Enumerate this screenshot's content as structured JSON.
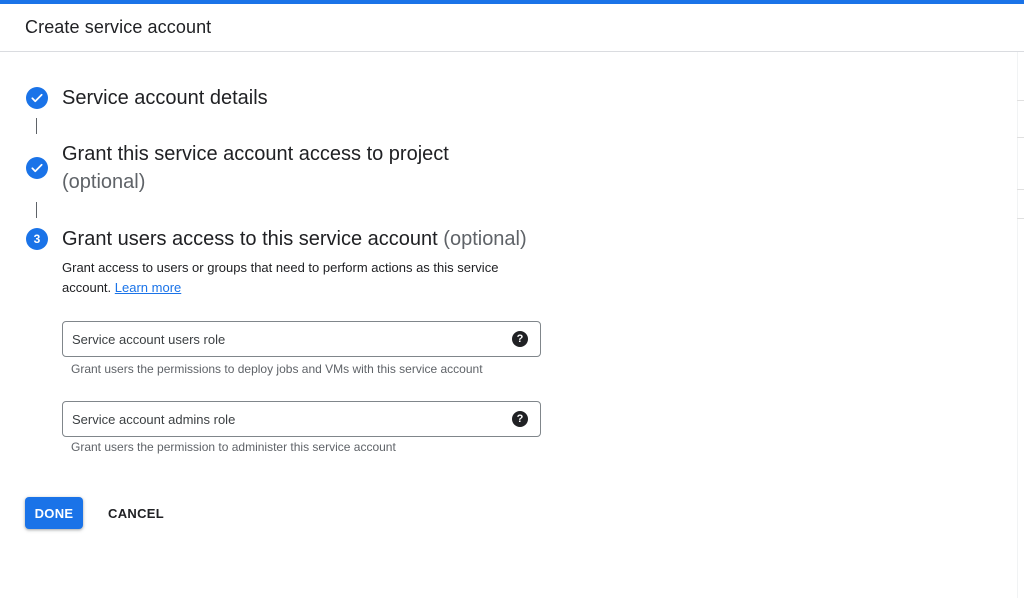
{
  "header": {
    "title": "Create service account"
  },
  "steps": [
    {
      "title": "Service account details",
      "status": "complete",
      "icon": "check-icon"
    },
    {
      "title": "Grant this service account access to project",
      "optional": "(optional)",
      "status": "complete",
      "icon": "check-icon"
    },
    {
      "number": "3",
      "title": "Grant users access to this service account",
      "optional": "(optional)",
      "status": "active"
    }
  ],
  "step3": {
    "description": "Grant access to users or groups that need to perform actions as this service account.",
    "learn_more": "Learn more",
    "fields": [
      {
        "placeholder": "Service account users role",
        "hint": "Grant users the permissions to deploy jobs and VMs with this service account",
        "icon": "help-icon"
      },
      {
        "placeholder": "Service account admins role",
        "hint": "Grant users the permission to administer this service account",
        "icon": "help-icon"
      }
    ],
    "help_glyph": "?"
  },
  "actions": {
    "done_label": "DONE",
    "cancel_label": "CANCEL"
  },
  "colors": {
    "accent": "#1a73e8",
    "text": "#202124",
    "muted": "#5f6368"
  }
}
